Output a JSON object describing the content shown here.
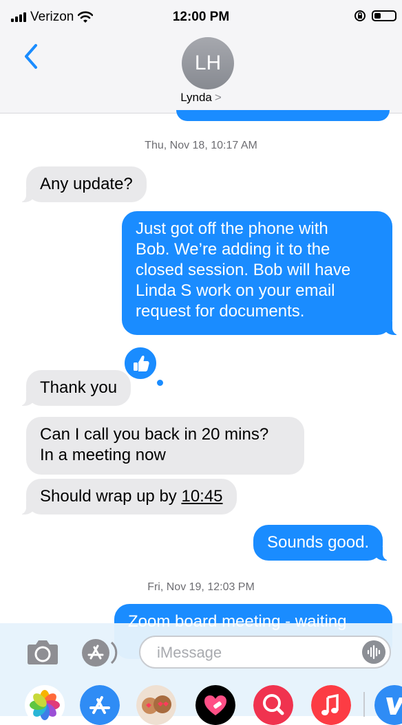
{
  "status_bar": {
    "carrier": "Verizon",
    "time": "12:00 PM"
  },
  "header": {
    "avatar_initials": "LH",
    "contact_name": "Lynda",
    "contact_chevron": ">"
  },
  "messages": {
    "ts1": "Thu, Nov 18, 10:17 AM",
    "m1": "Any update?",
    "m2": "Just got off the phone with\nBob.  We’re adding it to the\nclosed session.  Bob will have\nLinda S work on your email\nrequest for documents.",
    "m3": "Thank you",
    "m4": "Can I call you back in 20 mins?\nIn a meeting now",
    "m5_prefix": "Should wrap up by ",
    "m5_link": "10:45",
    "m6": "Sounds good.",
    "ts2": "Fri, Nov 19, 12:03 PM",
    "m7_partial": "Zoom board meeting - waiting"
  },
  "composer": {
    "placeholder": "iMessage"
  },
  "icons": [
    "signal-icon",
    "wifi-icon",
    "orientation-lock-icon",
    "battery-icon",
    "back-chevron-icon",
    "thumbs-up-icon",
    "camera-icon",
    "app-store-icon",
    "audio-waveform-icon",
    "photos-icon",
    "memoji-icon",
    "heart-icon",
    "search-icon",
    "music-icon",
    "venmo-icon"
  ],
  "colors": {
    "accent": "#1a8cff",
    "incoming_bubble": "#e9e9eb",
    "header_bg": "#f5f5f7"
  }
}
